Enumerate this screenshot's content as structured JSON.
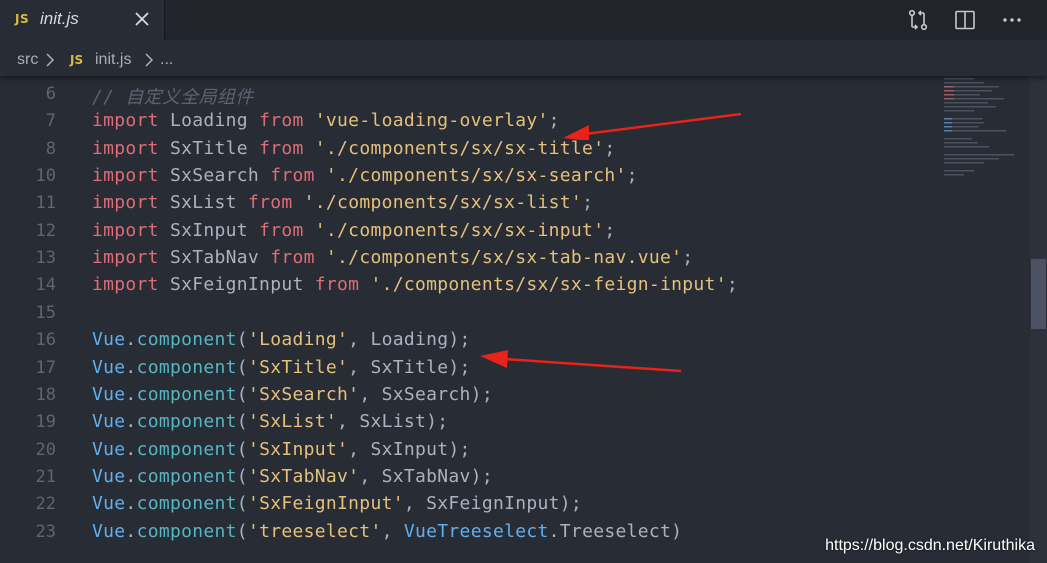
{
  "tab": {
    "lang_badge": "JS",
    "file_name": "init.js"
  },
  "breadcrumb": {
    "folder": "src",
    "lang_badge": "JS",
    "file": "init.js",
    "more": "..."
  },
  "editor": {
    "lines": [
      {
        "number": "6",
        "tokens": [
          {
            "t": "// 自定义全局组件",
            "c": "cm"
          }
        ]
      },
      {
        "number": "7",
        "tokens": [
          {
            "t": "import",
            "c": "kw"
          },
          {
            "t": " Loading ",
            "c": "id"
          },
          {
            "t": "from",
            "c": "kw"
          },
          {
            "t": " ",
            "c": "id"
          },
          {
            "t": "'vue-loading-overlay'",
            "c": "str"
          },
          {
            "t": ";",
            "c": "id"
          }
        ]
      },
      {
        "number": "8",
        "tokens": [
          {
            "t": "import",
            "c": "kw"
          },
          {
            "t": " SxTitle ",
            "c": "id"
          },
          {
            "t": "from",
            "c": "kw"
          },
          {
            "t": " ",
            "c": "id"
          },
          {
            "t": "'./components/sx/sx-title'",
            "c": "str"
          },
          {
            "t": ";",
            "c": "id"
          }
        ]
      },
      {
        "number": "10",
        "tokens": [
          {
            "t": "import",
            "c": "kw"
          },
          {
            "t": " SxSearch ",
            "c": "id"
          },
          {
            "t": "from",
            "c": "kw"
          },
          {
            "t": " ",
            "c": "id"
          },
          {
            "t": "'./components/sx/sx-search'",
            "c": "str"
          },
          {
            "t": ";",
            "c": "id"
          }
        ]
      },
      {
        "number": "11",
        "tokens": [
          {
            "t": "import",
            "c": "kw"
          },
          {
            "t": " SxList ",
            "c": "id"
          },
          {
            "t": "from",
            "c": "kw"
          },
          {
            "t": " ",
            "c": "id"
          },
          {
            "t": "'./components/sx/sx-list'",
            "c": "str"
          },
          {
            "t": ";",
            "c": "id"
          }
        ]
      },
      {
        "number": "12",
        "tokens": [
          {
            "t": "import",
            "c": "kw"
          },
          {
            "t": " SxInput ",
            "c": "id"
          },
          {
            "t": "from",
            "c": "kw"
          },
          {
            "t": " ",
            "c": "id"
          },
          {
            "t": "'./components/sx/sx-input'",
            "c": "str"
          },
          {
            "t": ";",
            "c": "id"
          }
        ]
      },
      {
        "number": "13",
        "tokens": [
          {
            "t": "import",
            "c": "kw"
          },
          {
            "t": " SxTabNav ",
            "c": "id"
          },
          {
            "t": "from",
            "c": "kw"
          },
          {
            "t": " ",
            "c": "id"
          },
          {
            "t": "'./components/sx/sx-tab-nav.vue'",
            "c": "str"
          },
          {
            "t": ";",
            "c": "id"
          }
        ]
      },
      {
        "number": "14",
        "tokens": [
          {
            "t": "import",
            "c": "kw"
          },
          {
            "t": " SxFeignInput ",
            "c": "id"
          },
          {
            "t": "from",
            "c": "kw"
          },
          {
            "t": " ",
            "c": "id"
          },
          {
            "t": "'./components/sx/sx-feign-input'",
            "c": "str"
          },
          {
            "t": ";",
            "c": "id"
          }
        ]
      },
      {
        "number": "15",
        "tokens": []
      },
      {
        "number": "16",
        "tokens": [
          {
            "t": "Vue",
            "c": "obj"
          },
          {
            "t": ".",
            "c": "id"
          },
          {
            "t": "component",
            "c": "fn"
          },
          {
            "t": "(",
            "c": "id"
          },
          {
            "t": "'Loading'",
            "c": "str"
          },
          {
            "t": ", Loading);",
            "c": "id"
          }
        ]
      },
      {
        "number": "17",
        "tokens": [
          {
            "t": "Vue",
            "c": "obj"
          },
          {
            "t": ".",
            "c": "id"
          },
          {
            "t": "component",
            "c": "fn"
          },
          {
            "t": "(",
            "c": "id"
          },
          {
            "t": "'SxTitle'",
            "c": "str"
          },
          {
            "t": ", SxTitle);",
            "c": "id"
          }
        ]
      },
      {
        "number": "18",
        "tokens": [
          {
            "t": "Vue",
            "c": "obj"
          },
          {
            "t": ".",
            "c": "id"
          },
          {
            "t": "component",
            "c": "fn"
          },
          {
            "t": "(",
            "c": "id"
          },
          {
            "t": "'SxSearch'",
            "c": "str"
          },
          {
            "t": ", SxSearch);",
            "c": "id"
          }
        ]
      },
      {
        "number": "19",
        "tokens": [
          {
            "t": "Vue",
            "c": "obj"
          },
          {
            "t": ".",
            "c": "id"
          },
          {
            "t": "component",
            "c": "fn"
          },
          {
            "t": "(",
            "c": "id"
          },
          {
            "t": "'SxList'",
            "c": "str"
          },
          {
            "t": ", SxList);",
            "c": "id"
          }
        ]
      },
      {
        "number": "20",
        "tokens": [
          {
            "t": "Vue",
            "c": "obj"
          },
          {
            "t": ".",
            "c": "id"
          },
          {
            "t": "component",
            "c": "fn"
          },
          {
            "t": "(",
            "c": "id"
          },
          {
            "t": "'SxInput'",
            "c": "str"
          },
          {
            "t": ", SxInput);",
            "c": "id"
          }
        ]
      },
      {
        "number": "21",
        "tokens": [
          {
            "t": "Vue",
            "c": "obj"
          },
          {
            "t": ".",
            "c": "id"
          },
          {
            "t": "component",
            "c": "fn"
          },
          {
            "t": "(",
            "c": "id"
          },
          {
            "t": "'SxTabNav'",
            "c": "str"
          },
          {
            "t": ", SxTabNav);",
            "c": "id"
          }
        ]
      },
      {
        "number": "22",
        "tokens": [
          {
            "t": "Vue",
            "c": "obj"
          },
          {
            "t": ".",
            "c": "id"
          },
          {
            "t": "component",
            "c": "fn"
          },
          {
            "t": "(",
            "c": "id"
          },
          {
            "t": "'SxFeignInput'",
            "c": "str"
          },
          {
            "t": ", SxFeignInput);",
            "c": "id"
          }
        ]
      },
      {
        "number": "23",
        "tokens": [
          {
            "t": "Vue",
            "c": "obj"
          },
          {
            "t": ".",
            "c": "id"
          },
          {
            "t": "component",
            "c": "fn"
          },
          {
            "t": "(",
            "c": "id"
          },
          {
            "t": "'treeselect'",
            "c": "str"
          },
          {
            "t": ", ",
            "c": "id"
          },
          {
            "t": "VueTreeselect",
            "c": "obj"
          },
          {
            "t": ".Treeselect)",
            "c": "id"
          }
        ]
      }
    ]
  },
  "watermark": "https://blog.csdn.net/Kiruthika",
  "colors": {
    "background": "#282c34",
    "keyword": "#e06c75",
    "string": "#e5c07b",
    "object": "#61afef",
    "method": "#56b6c2",
    "comment": "#5c6370",
    "annotation_arrow": "#e8231a"
  },
  "icons": {
    "tab_close": "close-icon",
    "action_1": "git-compare-icon",
    "action_2": "split-editor-icon",
    "action_3": "more-actions-icon"
  }
}
